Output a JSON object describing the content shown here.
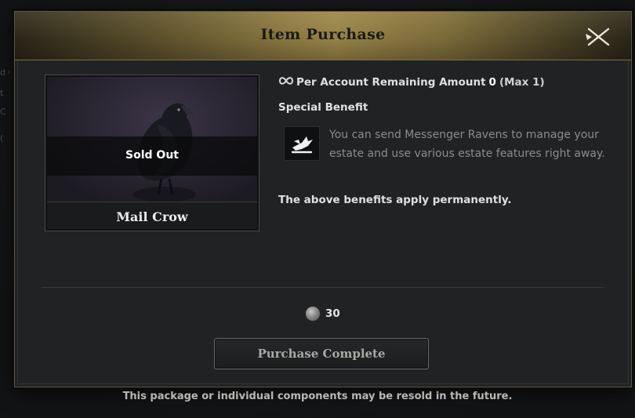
{
  "background": {
    "fragments": [
      "d C",
      "t",
      "C",
      "("
    ]
  },
  "dialog": {
    "title": "Item Purchase",
    "close_icon": "close-icon"
  },
  "item": {
    "name": "Mail Crow",
    "status": "Sold Out",
    "image_icon": "raven-icon"
  },
  "limit": {
    "label": "Per Account Remaining Amount",
    "remaining": "0",
    "max": "(Max 1)",
    "icon": "infinity-icon"
  },
  "benefit": {
    "section_title": "Special Benefit",
    "icon": "messenger-raven-icon",
    "description": "You can send Messenger Ravens to manage your estate and use various estate features right away.",
    "permanent_note": "The above benefits apply permanently."
  },
  "price": {
    "currency_icon": "silver-coin-icon",
    "amount": "30"
  },
  "purchase_button": {
    "label": "Purchase Complete"
  },
  "footnote": "This package or individual components may be resold in the future.",
  "colors": {
    "header_gold": "#9a8649",
    "panel": "#212223",
    "text_muted": "#8b8c8e"
  }
}
